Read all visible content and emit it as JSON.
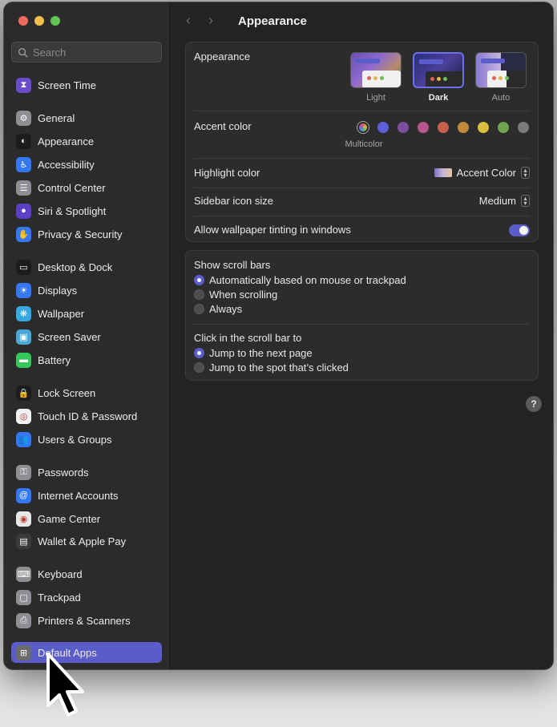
{
  "search": {
    "placeholder": "Search"
  },
  "sidebar": {
    "items": [
      {
        "label": "Screen Time",
        "icon": "hourglass-icon",
        "color": "#6a4bc9"
      },
      {
        "label": "General",
        "icon": "gear-icon",
        "color": "#8e8e93"
      },
      {
        "label": "Appearance",
        "icon": "appearance-icon",
        "color": "#1c1c1e"
      },
      {
        "label": "Accessibility",
        "icon": "accessibility-icon",
        "color": "#3478f6"
      },
      {
        "label": "Control Center",
        "icon": "control-center-icon",
        "color": "#8e8e93"
      },
      {
        "label": "Siri & Spotlight",
        "icon": "siri-icon",
        "color": "#5b3fc4"
      },
      {
        "label": "Privacy & Security",
        "icon": "hand-icon",
        "color": "#3478f6"
      },
      {
        "label": "Desktop & Dock",
        "icon": "dock-icon",
        "color": "#1c1c1e"
      },
      {
        "label": "Displays",
        "icon": "sun-icon",
        "color": "#3478f6"
      },
      {
        "label": "Wallpaper",
        "icon": "wallpaper-icon",
        "color": "#35a9e0"
      },
      {
        "label": "Screen Saver",
        "icon": "screen-saver-icon",
        "color": "#4aa8d8"
      },
      {
        "label": "Battery",
        "icon": "battery-icon",
        "color": "#34c759"
      },
      {
        "label": "Lock Screen",
        "icon": "lock-icon",
        "color": "#1c1c1e"
      },
      {
        "label": "Touch ID & Password",
        "icon": "fingerprint-icon",
        "color": "#f2f2f2"
      },
      {
        "label": "Users & Groups",
        "icon": "users-icon",
        "color": "#3478f6"
      },
      {
        "label": "Passwords",
        "icon": "key-icon",
        "color": "#8e8e93"
      },
      {
        "label": "Internet Accounts",
        "icon": "at-icon",
        "color": "#3478f6"
      },
      {
        "label": "Game Center",
        "icon": "game-center-icon",
        "color": "#e8e8e8"
      },
      {
        "label": "Wallet & Apple Pay",
        "icon": "wallet-icon",
        "color": "#3a3a3a"
      },
      {
        "label": "Keyboard",
        "icon": "keyboard-icon",
        "color": "#8e8e93"
      },
      {
        "label": "Trackpad",
        "icon": "trackpad-icon",
        "color": "#8e8e93"
      },
      {
        "label": "Printers & Scanners",
        "icon": "printer-icon",
        "color": "#8e8e93"
      },
      {
        "label": "Default Apps",
        "icon": "default-apps-icon",
        "color": "#6b6b6b"
      }
    ],
    "selected": "Default Apps"
  },
  "header": {
    "title": "Appearance",
    "back": "‹",
    "forward": "›"
  },
  "appearance": {
    "label": "Appearance",
    "options": [
      "Light",
      "Dark",
      "Auto"
    ],
    "selected": "Dark"
  },
  "accent": {
    "label": "Accent color",
    "caption": "Multicolor",
    "colors": [
      "multicolor",
      "#5d60d6",
      "#7c4f9a",
      "#b7568a",
      "#c9604e",
      "#c48a3b",
      "#d9be3f",
      "#6fa552",
      "#7a7a7a"
    ]
  },
  "highlight": {
    "label": "Highlight color",
    "value": "Accent Color"
  },
  "sidebar_icon_size": {
    "label": "Sidebar icon size",
    "value": "Medium"
  },
  "wallpaper_tinting": {
    "label": "Allow wallpaper tinting in windows",
    "on": true
  },
  "scroll_bars": {
    "label": "Show scroll bars",
    "options": [
      "Automatically based on mouse or trackpad",
      "When scrolling",
      "Always"
    ],
    "selected_index": 0
  },
  "click_scroll": {
    "label": "Click in the scroll bar to",
    "options": [
      "Jump to the next page",
      "Jump to the spot that’s clicked"
    ],
    "selected_index": 0
  },
  "help": {
    "label": "?"
  }
}
